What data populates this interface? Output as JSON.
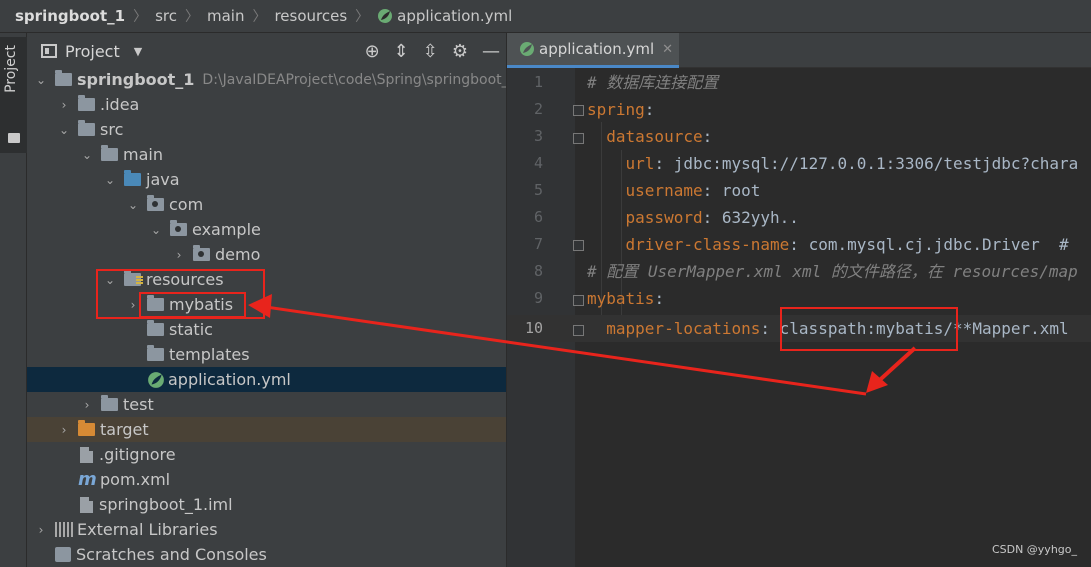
{
  "breadcrumb": [
    "springboot_1",
    "src",
    "main",
    "resources",
    "application.yml"
  ],
  "stripe": {
    "label": "Project"
  },
  "project_panel": {
    "title": "Project"
  },
  "tree": [
    {
      "label": "springboot_1",
      "path": "D:\\JavaIDEAProject\\code\\Spring\\springboot_1",
      "arrow": "⌄"
    },
    {
      "label": ".idea",
      "arrow": "›"
    },
    {
      "label": "src",
      "arrow": "⌄"
    },
    {
      "label": "main",
      "arrow": "⌄"
    },
    {
      "label": "java",
      "arrow": "⌄"
    },
    {
      "label": "com",
      "arrow": "⌄"
    },
    {
      "label": "example",
      "arrow": "⌄"
    },
    {
      "label": "demo",
      "arrow": "›"
    },
    {
      "label": "resources",
      "arrow": "⌄"
    },
    {
      "label": "mybatis",
      "arrow": "›"
    },
    {
      "label": "static",
      "arrow": ""
    },
    {
      "label": "templates",
      "arrow": ""
    },
    {
      "label": "application.yml",
      "arrow": ""
    },
    {
      "label": "test",
      "arrow": "›"
    },
    {
      "label": "target",
      "arrow": "›"
    },
    {
      "label": ".gitignore",
      "arrow": ""
    },
    {
      "label": "pom.xml",
      "arrow": ""
    },
    {
      "label": "springboot_1.iml",
      "arrow": ""
    },
    {
      "label": "External Libraries",
      "arrow": "›"
    },
    {
      "label": "Scratches and Consoles",
      "arrow": ""
    }
  ],
  "editor": {
    "tab": "application.yml",
    "line_numbers": [
      "1",
      "2",
      "3",
      "4",
      "5",
      "6",
      "7",
      "8",
      "9",
      "10"
    ],
    "lines": [
      {
        "comment": "# 数据库连接配置"
      },
      {
        "indent": "",
        "key": "spring",
        "sep": ":",
        "value": ""
      },
      {
        "indent": "  ",
        "key": "datasource",
        "sep": ":",
        "value": ""
      },
      {
        "indent": "    ",
        "key": "url",
        "sep": ": ",
        "value": "jdbc:mysql://127.0.0.1:3306/testjdbc?chara"
      },
      {
        "indent": "    ",
        "key": "username",
        "sep": ": ",
        "value": "root"
      },
      {
        "indent": "    ",
        "key": "password",
        "sep": ": ",
        "value": "632yyh.."
      },
      {
        "indent": "    ",
        "key": "driver-class-name",
        "sep": ": ",
        "value": "com.mysql.cj.jdbc.Driver  #"
      },
      {
        "comment": "# 配置 UserMapper.xml xml 的文件路径，在 resources/map"
      },
      {
        "indent": "",
        "key": "mybatis",
        "sep": ":",
        "value": ""
      },
      {
        "indent": "  ",
        "key": "mapper-locations",
        "sep": ": ",
        "value": "classpath:mybatis/**Mapper.xml"
      }
    ]
  },
  "watermark": "CSDN @yyhgo_",
  "colors": {
    "annotation": "#e8241c",
    "selection": "#0d293e",
    "key": "#cc7832",
    "comment": "#808080"
  }
}
